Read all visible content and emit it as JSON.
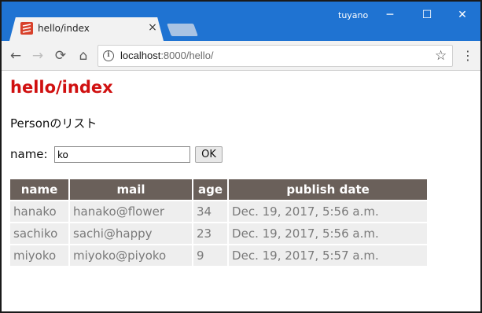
{
  "browser": {
    "tab_title": "hello/index",
    "tab_close": "×",
    "user_label": "tuyano",
    "window_buttons": {
      "minimize": "─",
      "maximize": "☐",
      "close": "✕"
    },
    "url_host": "localhost",
    "url_path": ":8000/hello/",
    "icons": {
      "back": "←",
      "forward": "→",
      "reload": "⟳",
      "home": "⌂",
      "info": "i",
      "star": "☆",
      "menu": "⋮"
    }
  },
  "page": {
    "title": "hello/index",
    "subtitle": "Personのリスト",
    "form": {
      "name_label": "name:",
      "name_value": "ko",
      "ok_label": "OK"
    },
    "table": {
      "headers": [
        "name",
        "mail",
        "age",
        "publish date"
      ],
      "rows": [
        [
          "hanako",
          "hanako@flower",
          "34",
          "Dec. 19, 2017, 5:56 a.m."
        ],
        [
          "sachiko",
          "sachi@happy",
          "23",
          "Dec. 19, 2017, 5:56 a.m."
        ],
        [
          "miyoko",
          "miyoko@piyoko",
          "9",
          "Dec. 19, 2017, 5:57 a.m."
        ]
      ]
    }
  },
  "colors": {
    "titlebar": "#1f73d2",
    "page_title": "#d01010",
    "table_header": "#6a605a",
    "table_cell": "#eeeeee"
  }
}
